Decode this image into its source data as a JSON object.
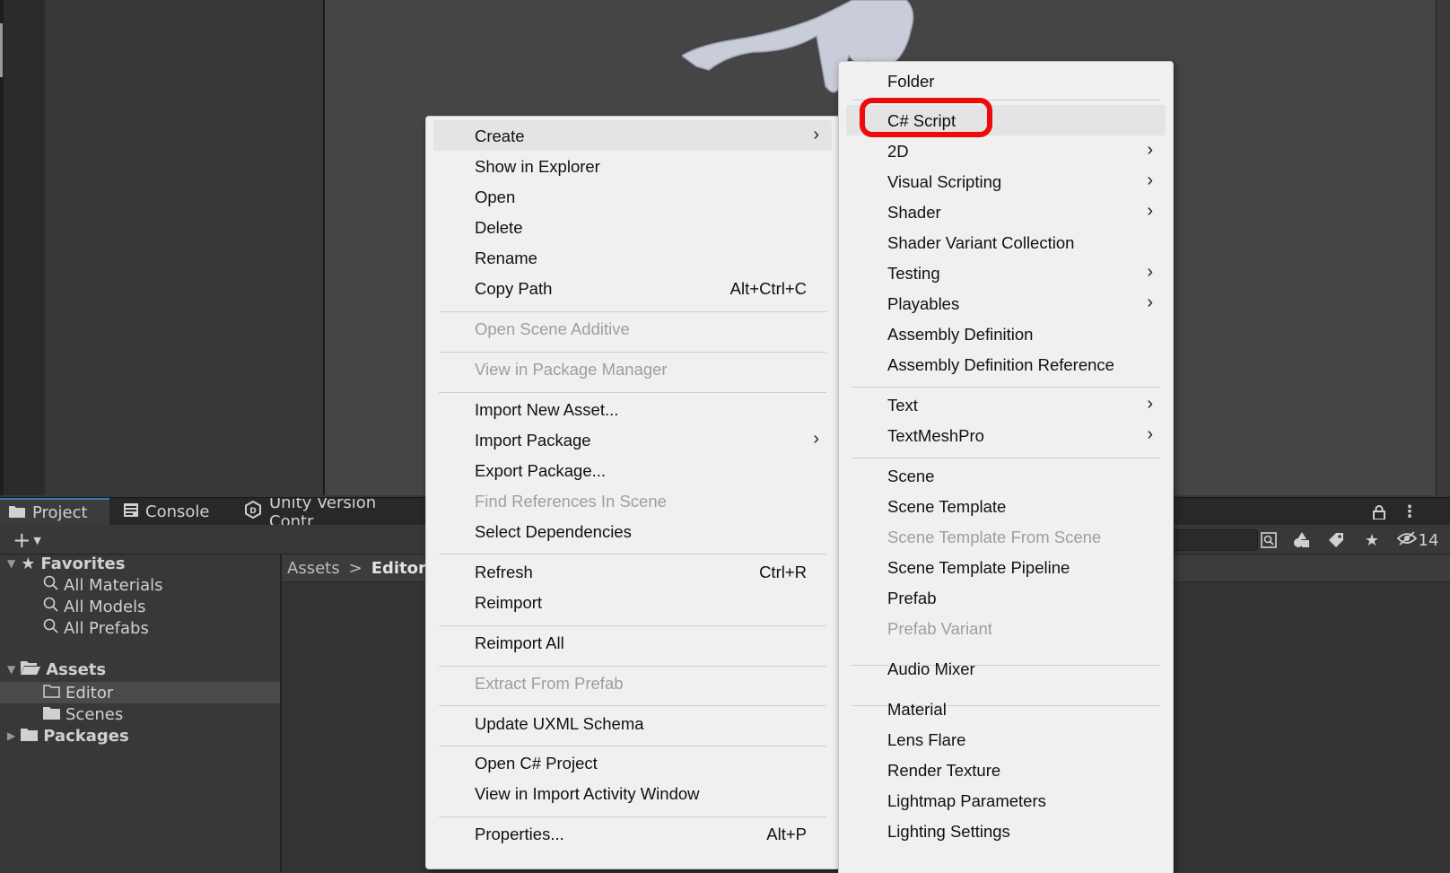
{
  "tabs": [
    {
      "label": "Project",
      "icon": "folder-icon"
    },
    {
      "label": "Console",
      "icon": "console-icon"
    },
    {
      "label": "Unity Version Contr",
      "icon": "unity-version-control-icon"
    }
  ],
  "toolbar": {
    "add_label": "+",
    "hidden_count": "14"
  },
  "tree": {
    "favorites": {
      "label": "Favorites",
      "items": [
        "All Materials",
        "All Models",
        "All Prefabs"
      ]
    },
    "assets": {
      "label": "Assets",
      "items": [
        "Editor",
        "Scenes"
      ],
      "selected": "Editor"
    },
    "packages": {
      "label": "Packages"
    }
  },
  "breadcrumb": {
    "root": "Assets",
    "separator": ">",
    "current": "Editor"
  },
  "context_menu": {
    "items": [
      {
        "label": "Create",
        "submenu": true,
        "highlighted": true
      },
      {
        "label": "Show in Explorer"
      },
      {
        "label": "Open"
      },
      {
        "label": "Delete"
      },
      {
        "label": "Rename"
      },
      {
        "label": "Copy Path",
        "shortcut": "Alt+Ctrl+C"
      },
      {
        "label": "Open Scene Additive",
        "disabled": true
      },
      {
        "label": "View in Package Manager",
        "disabled": true
      },
      {
        "label": "Import New Asset..."
      },
      {
        "label": "Import Package",
        "submenu": true
      },
      {
        "label": "Export Package..."
      },
      {
        "label": "Find References In Scene",
        "disabled": true
      },
      {
        "label": "Select Dependencies"
      },
      {
        "label": "Refresh",
        "shortcut": "Ctrl+R"
      },
      {
        "label": "Reimport"
      },
      {
        "label": "Reimport All"
      },
      {
        "label": "Extract From Prefab",
        "disabled": true
      },
      {
        "label": "Update UXML Schema"
      },
      {
        "label": "Open C# Project"
      },
      {
        "label": "View in Import Activity Window"
      },
      {
        "label": "Properties...",
        "shortcut": "Alt+P"
      }
    ]
  },
  "create_submenu": {
    "items": [
      {
        "label": "Folder"
      },
      {
        "label": "C# Script",
        "highlighted": true,
        "annotated": true
      },
      {
        "label": "2D",
        "submenu": true
      },
      {
        "label": "Visual Scripting",
        "submenu": true
      },
      {
        "label": "Shader",
        "submenu": true
      },
      {
        "label": "Shader Variant Collection"
      },
      {
        "label": "Testing",
        "submenu": true
      },
      {
        "label": "Playables",
        "submenu": true
      },
      {
        "label": "Assembly Definition"
      },
      {
        "label": "Assembly Definition Reference"
      },
      {
        "label": "Text",
        "submenu": true
      },
      {
        "label": "TextMeshPro",
        "submenu": true
      },
      {
        "label": "Scene"
      },
      {
        "label": "Scene Template"
      },
      {
        "label": "Scene Template From Scene",
        "disabled": true
      },
      {
        "label": "Scene Template Pipeline"
      },
      {
        "label": "Prefab"
      },
      {
        "label": "Prefab Variant",
        "disabled": true
      },
      {
        "label": "Audio Mixer"
      },
      {
        "label": "Material"
      },
      {
        "label": "Lens Flare"
      },
      {
        "label": "Render Texture"
      },
      {
        "label": "Lightmap Parameters"
      },
      {
        "label": "Lighting Settings"
      }
    ]
  },
  "colors": {
    "annotation_ring": "#ee0b0b",
    "menu_bg": "#f0f0f0",
    "editor_bg": "#383838",
    "scene_bg": "#454545",
    "tab_accent": "#3a79bb"
  }
}
